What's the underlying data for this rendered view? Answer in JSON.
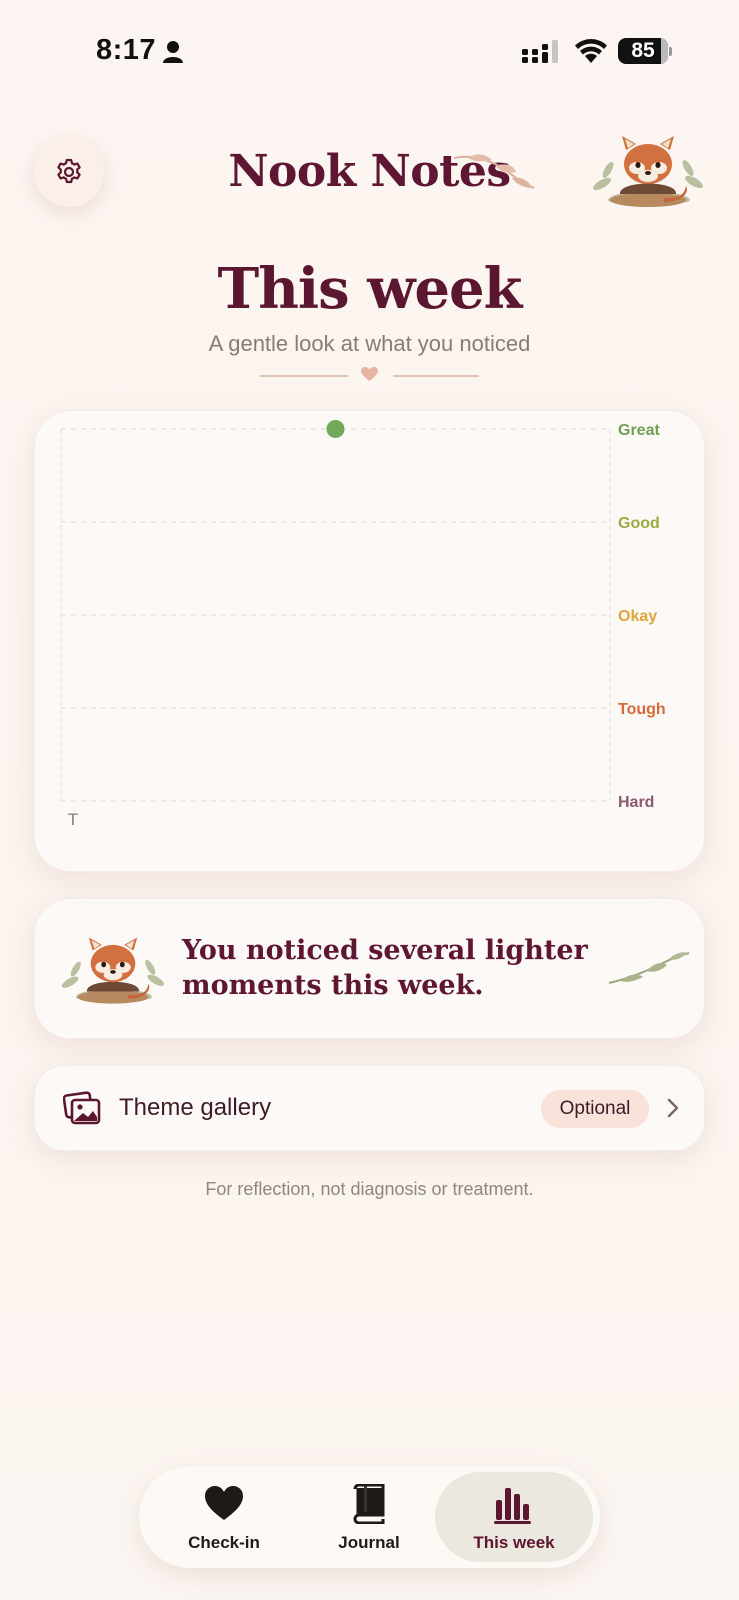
{
  "status_bar": {
    "time": "8:17",
    "battery": "85"
  },
  "header": {
    "app_title": "Nook Notes"
  },
  "page": {
    "title": "This week",
    "subtitle": "A gentle look at what you noticed"
  },
  "chart_data": {
    "type": "scatter",
    "y_categories": [
      "Hard",
      "Tough",
      "Okay",
      "Good",
      "Great"
    ],
    "y_colors": [
      "#8b5a6a",
      "#d86a3a",
      "#e0a43a",
      "#9aab45",
      "#6fa052"
    ],
    "x_ticks": [
      "T"
    ],
    "points": [
      {
        "x": "T",
        "y": "Great",
        "color": "#72a85a"
      }
    ],
    "grid": true,
    "y_axis_position": "right"
  },
  "insight": {
    "text": "You noticed several lighter moments this week."
  },
  "gallery": {
    "label": "Theme gallery",
    "badge": "Optional"
  },
  "disclaimer": "For reflection, not diagnosis or treatment.",
  "tabs": [
    {
      "label": "Check-in",
      "icon": "heart-icon",
      "active": false
    },
    {
      "label": "Journal",
      "icon": "book-icon",
      "active": false
    },
    {
      "label": "This week",
      "icon": "bar-chart-icon",
      "active": true
    }
  ],
  "colors": {
    "accent": "#5b1630",
    "background": "#fcf6f2",
    "card": "#fdf9f6"
  }
}
